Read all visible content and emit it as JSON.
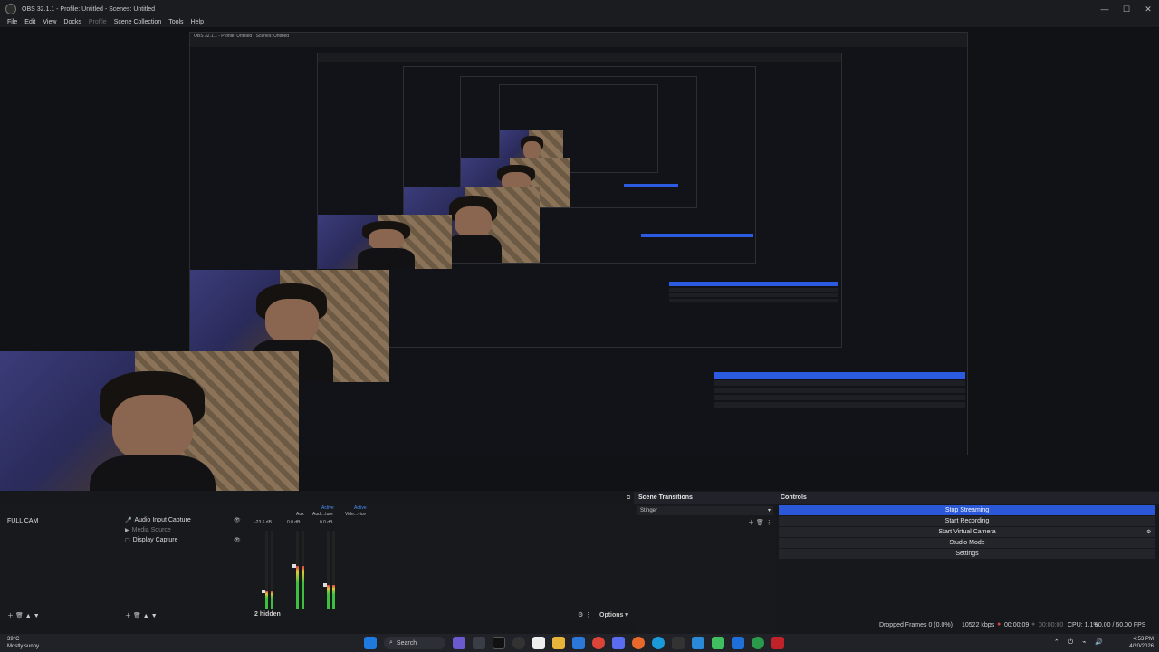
{
  "window": {
    "title": "OBS 32.1.1 - Profile: Untitled - Scenes: Untitled",
    "minimize": "—",
    "maximize": "☐",
    "close": "✕"
  },
  "menu": {
    "items": [
      "File",
      "Edit",
      "View",
      "Docks"
    ],
    "profile": "Profile",
    "items2": [
      "Scene Collection",
      "Tools",
      "Help"
    ]
  },
  "scenes": {
    "items": [
      "FULL CAM"
    ]
  },
  "sources": {
    "items": [
      {
        "label": "Audio Input Capture",
        "dim": false
      },
      {
        "label": "Media Source",
        "dim": true
      },
      {
        "label": "Display Capture",
        "dim": false
      }
    ]
  },
  "mixer": {
    "channels": [
      {
        "name": "Aux",
        "active": "",
        "db": "-23.6 dB",
        "level": 0.22
      },
      {
        "name": "Audi...ture",
        "active": "Active",
        "db": "0.0 dB",
        "level": 0.55
      },
      {
        "name": "Vide...vice",
        "active": "Active",
        "db": "0.0 dB",
        "level": 0.3
      }
    ],
    "hidden": "2 hidden",
    "options": "Options"
  },
  "transitions": {
    "title": "Scene Transitions",
    "selected": "Stinger"
  },
  "controls": {
    "title": "Controls",
    "buttons": [
      "Stop Streaming",
      "Start Recording",
      "Start Virtual Camera",
      "Studio Mode",
      "Settings"
    ]
  },
  "status": {
    "dropped": "Dropped Frames 0 (0.0%)",
    "bitrate": "10522 kbps",
    "stream_time": "00:00:09",
    "rec_time": "00:00:00",
    "cpu": "CPU: 1.1%",
    "fps": "60.00 / 60.00 FPS"
  },
  "taskbar": {
    "weather_temp": "39°C",
    "weather_desc": "Mostly sunny",
    "search": "Search",
    "time": "4:53 PM",
    "date": "4/20/2026"
  },
  "colors": {
    "accent": "#2a58d8",
    "meter_green": "#3fbf3f",
    "meter_yellow": "#d8c83a",
    "meter_red": "#d84040"
  }
}
